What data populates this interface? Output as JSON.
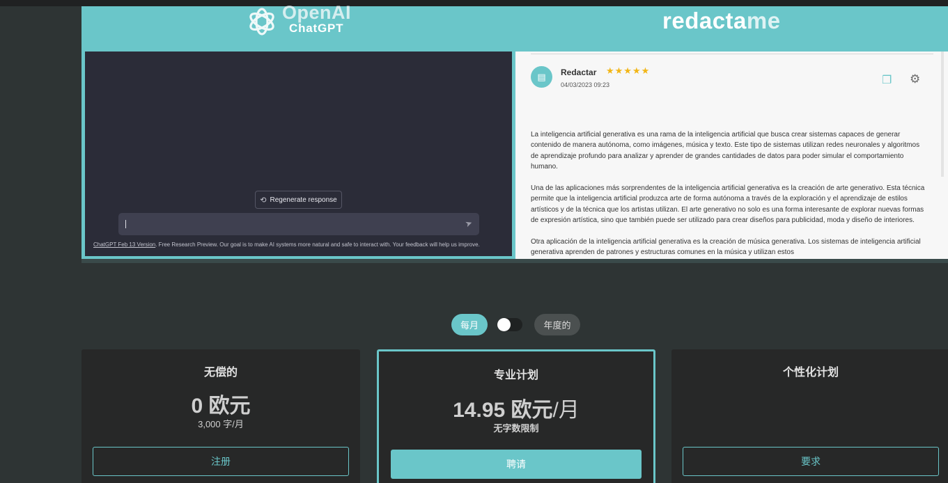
{
  "hero": {
    "openai_word": "OpenAI",
    "chatgpt_word": "ChatGPT",
    "redactame_main": "redacta",
    "redactame_suffix": "me"
  },
  "chatgpt": {
    "regenerate_icon": "refresh-icon",
    "regenerate_label": "Regenerate response",
    "prompt_value": "",
    "send_icon": "send-icon",
    "footer_link": "ChatGPT Feb 13 Version",
    "footer_text": ". Free Research Preview. Our goal is to make AI systems more natural and safe to interact with. Your feedback will help us improve."
  },
  "redactame": {
    "author": "Redactar",
    "stars": "★★★★★",
    "rating": 5,
    "date": "04/03/2023 09:23",
    "paragraphs": [
      "La inteligencia artificial generativa es una rama de la inteligencia artificial que busca crear sistemas capaces de generar contenido de manera autónoma, como imágenes, música y texto. Este tipo de sistemas utilizan redes neuronales y algoritmos de aprendizaje profundo para analizar y aprender de grandes cantidades de datos para poder simular el comportamiento humano.",
      "Una de las aplicaciones más sorprendentes de la inteligencia artificial generativa es la creación de arte generativo. Esta técnica permite que la inteligencia artificial produzca arte de forma autónoma a través de la exploración y el aprendizaje de estilos artísticos y de la técnica que los artistas utilizan. El arte generativo no solo es una forma interesante de explorar nuevas formas de expresión artística, sino que también puede ser utilizado para crear diseños para publicidad, moda y diseño de interiores.",
      "Otra aplicación de la inteligencia artificial generativa es la creación de música generativa. Los sistemas de inteligencia artificial generativa aprenden de patrones y estructuras comunes en la música y utilizan estos"
    ]
  },
  "billing_toggle": {
    "monthly": "每月",
    "yearly": "年度的",
    "selected": "monthly"
  },
  "plans": {
    "free": {
      "title": "无偿的",
      "price": "0 欧元",
      "quota": "3,000 字/月",
      "button": "注册"
    },
    "pro": {
      "title": "专业计划",
      "price": "14.95 欧元",
      "per": "/月",
      "quota": "无字数限制",
      "button": "聘请"
    },
    "custom": {
      "title": "个性化计划",
      "button": "要求"
    }
  },
  "colors": {
    "accent": "#6ac6c9",
    "background": "#2e3434",
    "card": "#272828",
    "chatgpt_bg": "#2b2c38",
    "star": "#f2b617"
  }
}
